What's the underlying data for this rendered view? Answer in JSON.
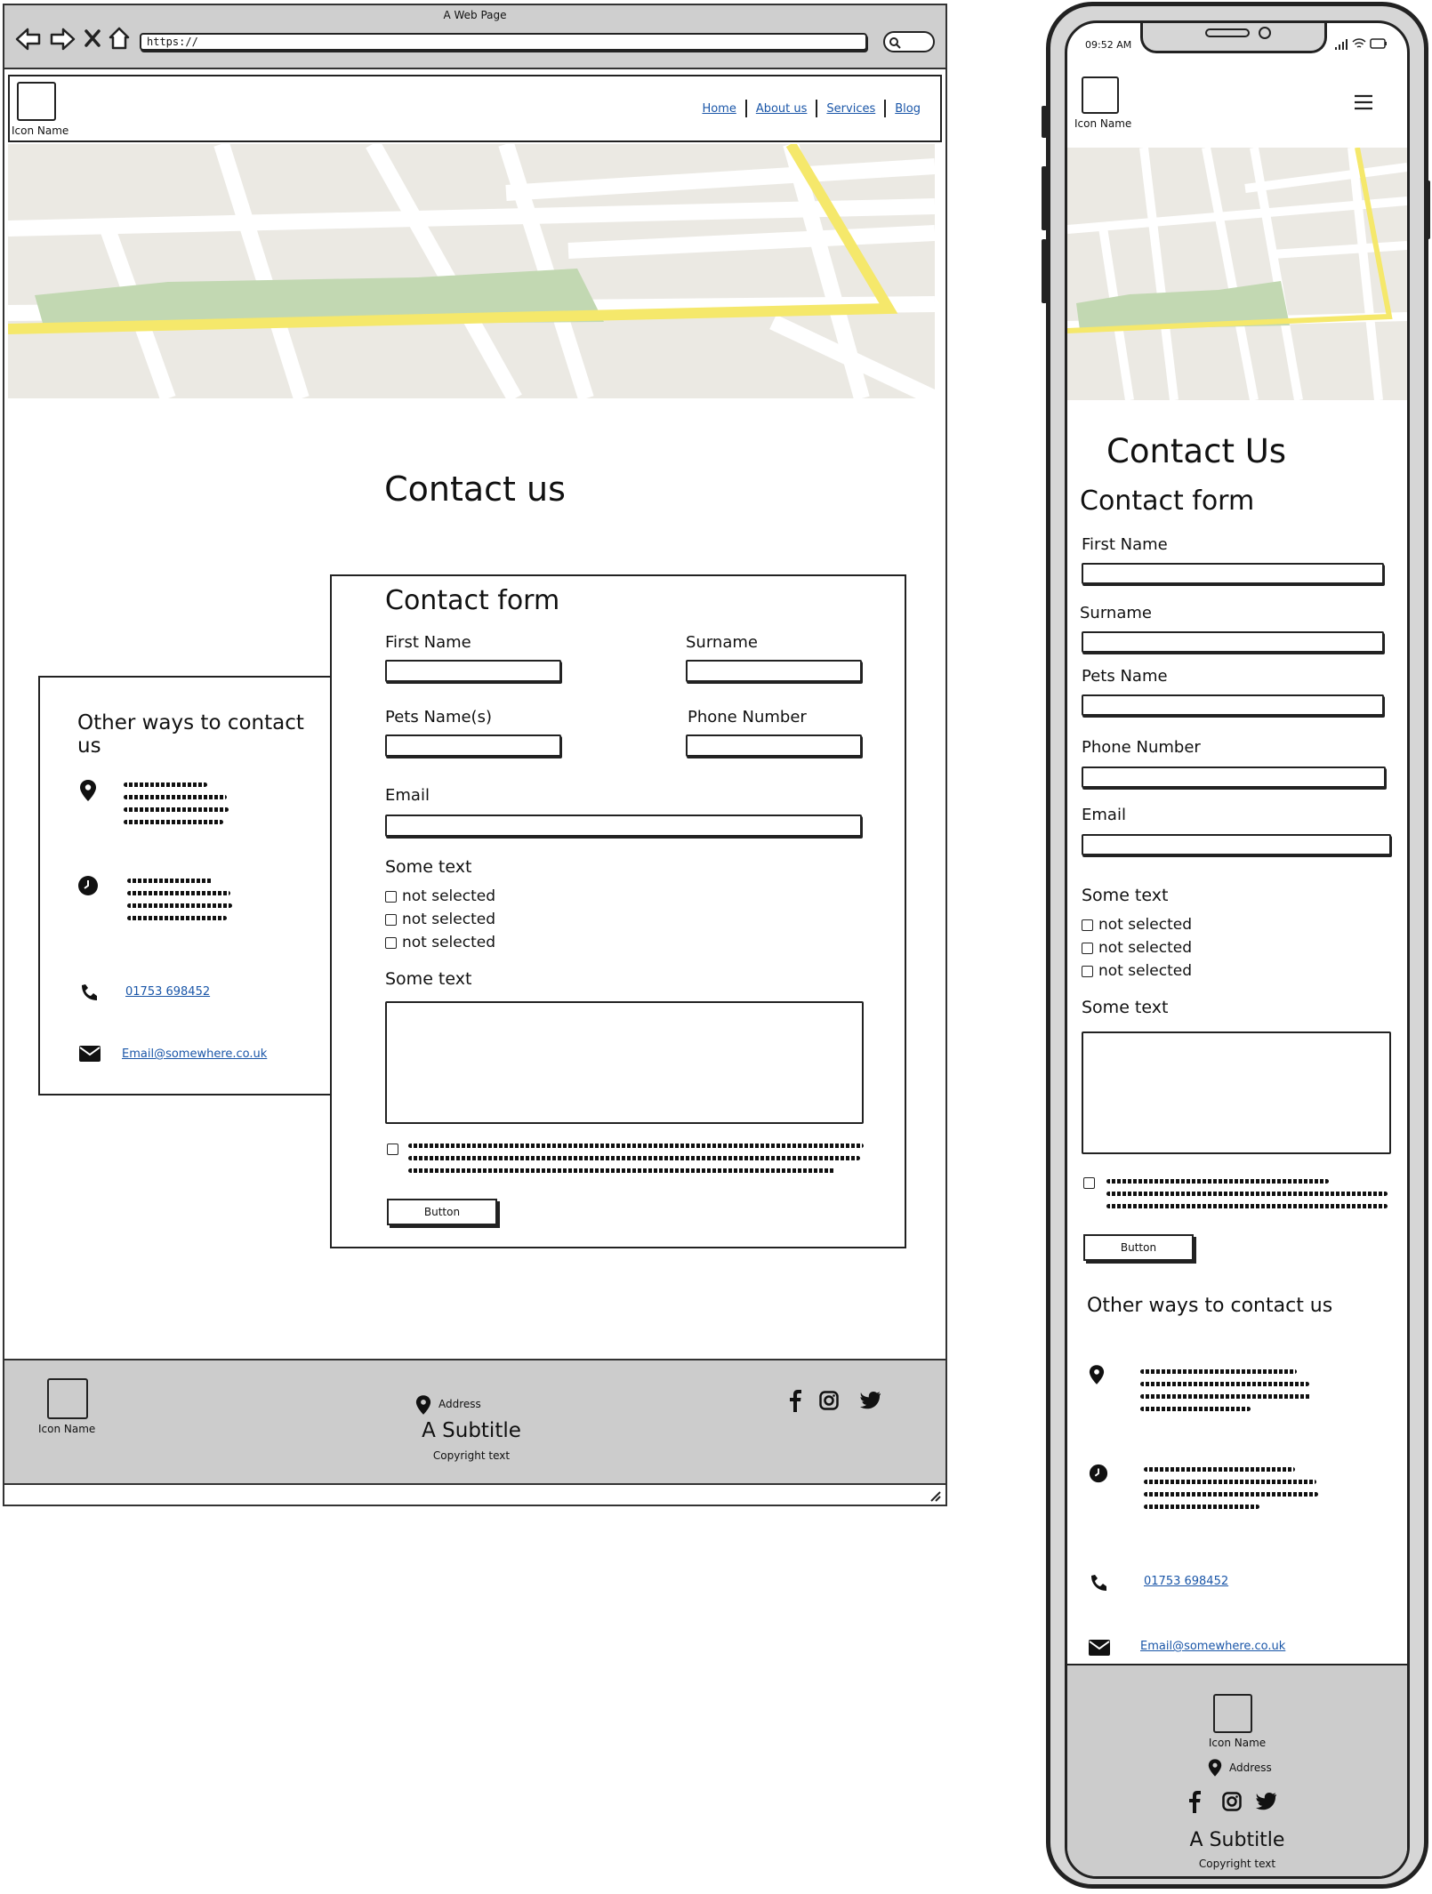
{
  "browser": {
    "window_title": "A Web Page",
    "url": "https://"
  },
  "colors": {
    "map_ground": "#ebe9e3",
    "map_park": "#c2d8b2",
    "map_route": "#f5e86b",
    "footer_bg": "#cccccc",
    "link": "#1a56a8"
  },
  "desktop": {
    "header": {
      "logo_label": "Icon Name",
      "nav": [
        "Home",
        "About us",
        "Services",
        "Blog"
      ]
    },
    "page_title": "Contact us",
    "other_ways": {
      "title": "Other ways to contact us",
      "phone": "01753 698452",
      "email": "Email@somewhere.co.uk",
      "icons": [
        "location-pin-icon",
        "clock-icon",
        "phone-icon",
        "envelope-icon"
      ]
    },
    "form": {
      "title": "Contact form",
      "first_name_label": "First Name",
      "surname_label": "Surname",
      "pets_label": "Pets Name(s)",
      "phone_label": "Phone Number",
      "email_label": "Email",
      "checkbox_group_label": "Some text",
      "checkbox_options": [
        "not selected",
        "not selected",
        "not selected"
      ],
      "textarea_label": "Some text",
      "button_label": "Button"
    },
    "footer": {
      "logo_label": "Icon Name",
      "address_label": "Address",
      "subtitle": "A Subtitle",
      "copyright": "Copyright text",
      "social_icons": [
        "facebook-icon",
        "instagram-icon",
        "twitter-icon"
      ]
    }
  },
  "mobile": {
    "status_time": "09:52 AM",
    "header": {
      "logo_label": "Icon Name"
    },
    "page_title": "Contact Us",
    "form": {
      "title": "Contact form",
      "first_name_label": "First Name",
      "surname_label": "Surname",
      "pets_label": "Pets Name",
      "phone_label": "Phone Number",
      "email_label": "Email",
      "checkbox_group_label": "Some text",
      "checkbox_options": [
        "not selected",
        "not selected",
        "not selected"
      ],
      "textarea_label": "Some text",
      "button_label": "Button"
    },
    "other_ways": {
      "title": "Other ways to contact us",
      "phone": "01753 698452",
      "email": "Email@somewhere.co.uk"
    },
    "footer": {
      "logo_label": "Icon Name",
      "address_label": "Address",
      "subtitle": "A Subtitle",
      "copyright": "Copyright text"
    }
  }
}
